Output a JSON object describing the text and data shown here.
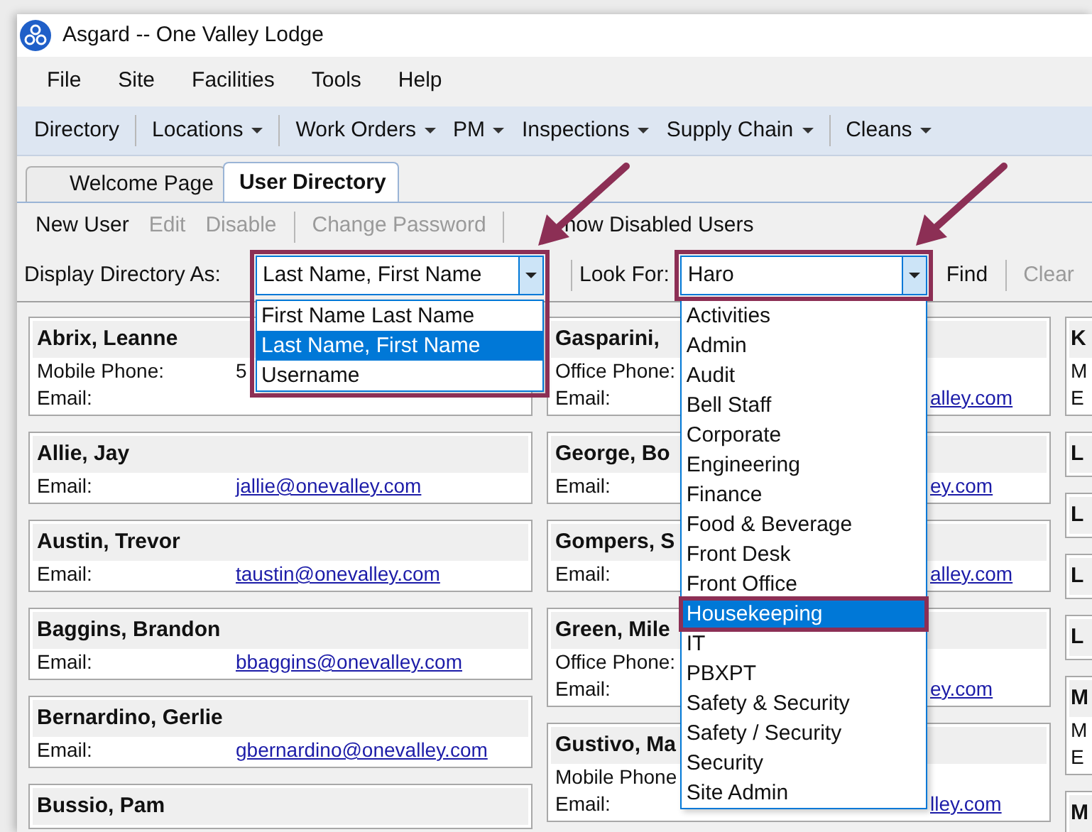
{
  "window": {
    "title": "Asgard -- One Valley Lodge"
  },
  "menu": [
    {
      "label": "File"
    },
    {
      "label": "Site"
    },
    {
      "label": "Facilities"
    },
    {
      "label": "Tools"
    },
    {
      "label": "Help"
    }
  ],
  "toolbar": {
    "groups": [
      [
        {
          "label": "Directory",
          "dropdown": false
        }
      ],
      [
        {
          "label": "Locations",
          "dropdown": true
        }
      ],
      [
        {
          "label": "Work Orders",
          "dropdown": true
        },
        {
          "label": "PM",
          "dropdown": true
        },
        {
          "label": "Inspections",
          "dropdown": true
        },
        {
          "label": "Supply Chain",
          "dropdown": true
        }
      ],
      [
        {
          "label": "Cleans",
          "dropdown": true
        }
      ]
    ]
  },
  "tabs": [
    {
      "label": "Welcome Page",
      "selected": false
    },
    {
      "label": "User Directory",
      "selected": true
    }
  ],
  "actions": {
    "groups": [
      [
        {
          "label": "New User",
          "disabled": false
        },
        {
          "label": "Edit",
          "disabled": true
        },
        {
          "label": "Disable",
          "disabled": true
        }
      ],
      [
        {
          "label": "Change Password",
          "disabled": true
        }
      ],
      [
        {
          "label": "how Disabled Users",
          "disabled": false
        }
      ]
    ]
  },
  "filter": {
    "display": {
      "label": "Display Directory As:",
      "value": "Last Name, First Name",
      "expanded": true,
      "options": [
        {
          "label": "First Name Last Name",
          "selected": false
        },
        {
          "label": "Last Name, First Name",
          "selected": true
        },
        {
          "label": "Username",
          "selected": false
        }
      ]
    },
    "look_for": {
      "label": "Look For:",
      "value": "Haro",
      "expanded": true,
      "options": [
        {
          "label": "Activities",
          "selected": false
        },
        {
          "label": "Admin",
          "selected": false
        },
        {
          "label": "Audit",
          "selected": false
        },
        {
          "label": "Bell Staff",
          "selected": false
        },
        {
          "label": "Corporate",
          "selected": false
        },
        {
          "label": "Engineering",
          "selected": false
        },
        {
          "label": "Finance",
          "selected": false
        },
        {
          "label": "Food & Beverage",
          "selected": false
        },
        {
          "label": "Front Desk",
          "selected": false
        },
        {
          "label": "Front Office",
          "selected": false
        },
        {
          "label": "Housekeeping",
          "selected": true
        },
        {
          "label": "IT",
          "selected": false
        },
        {
          "label": "PBXPT",
          "selected": false
        },
        {
          "label": "Safety & Security",
          "selected": false
        },
        {
          "label": "Safety / Security",
          "selected": false
        },
        {
          "label": "Security",
          "selected": false
        },
        {
          "label": "Site Admin",
          "selected": false
        }
      ]
    },
    "buttons": [
      {
        "label": "Find",
        "disabled": false
      },
      {
        "label": "Clear",
        "disabled": true
      }
    ]
  },
  "directory": {
    "columns": [
      {
        "cards": [
          {
            "name": "Abrix, Leanne",
            "fields": [
              {
                "label": "Mobile Phone:",
                "value": "5",
                "link": false
              },
              {
                "label": "Email:"
              }
            ]
          },
          {
            "name": "Allie, Jay",
            "fields": [
              {
                "label": "Email:",
                "value": "jallie@onevalley.com",
                "link": true
              }
            ]
          },
          {
            "name": "Austin, Trevor",
            "fields": [
              {
                "label": "Email:",
                "value": "taustin@onevalley.com",
                "link": true
              }
            ]
          },
          {
            "name": "Baggins, Brandon",
            "fields": [
              {
                "label": "Email:",
                "value": "bbaggins@onevalley.com",
                "link": true
              }
            ]
          },
          {
            "name": "Bernardino, Gerlie",
            "fields": [
              {
                "label": "Email:",
                "value": "gbernardino@onevalley.com",
                "link": true
              }
            ]
          },
          {
            "name": "Bussio, Pam"
          }
        ]
      },
      {
        "cards": [
          {
            "name": "Gasparini,",
            "fields": [
              {
                "label": "Office Phone:"
              },
              {
                "label": "Email:",
                "value": "alley.com",
                "link": true
              }
            ]
          },
          {
            "name": "George, Bo",
            "fields": [
              {
                "label": "Email:",
                "value": "ey.com",
                "link": true
              }
            ]
          },
          {
            "name": "Gompers, S",
            "fields": [
              {
                "label": "Email:",
                "value": "alley.com",
                "link": true
              }
            ]
          },
          {
            "name": "Green, Mile",
            "fields": [
              {
                "label": "Office Phone:"
              },
              {
                "label": "Email:",
                "value": "ey.com",
                "link": true
              }
            ]
          },
          {
            "name": "Gustivo, Ma",
            "fields": [
              {
                "label": "Mobile Phone"
              },
              {
                "label": "Email:",
                "value": "lley.com",
                "link": true
              }
            ]
          }
        ]
      },
      {
        "cards": [
          {
            "name": "K",
            "fields": [
              {
                "label": "M"
              },
              {
                "label": "E"
              }
            ]
          },
          {
            "name": "L"
          },
          {
            "name": "L"
          },
          {
            "name": "L"
          },
          {
            "name": "L"
          },
          {
            "name": "M",
            "fields": [
              {
                "label": "M"
              },
              {
                "label": "E"
              }
            ]
          },
          {
            "name": "M"
          }
        ]
      }
    ]
  }
}
